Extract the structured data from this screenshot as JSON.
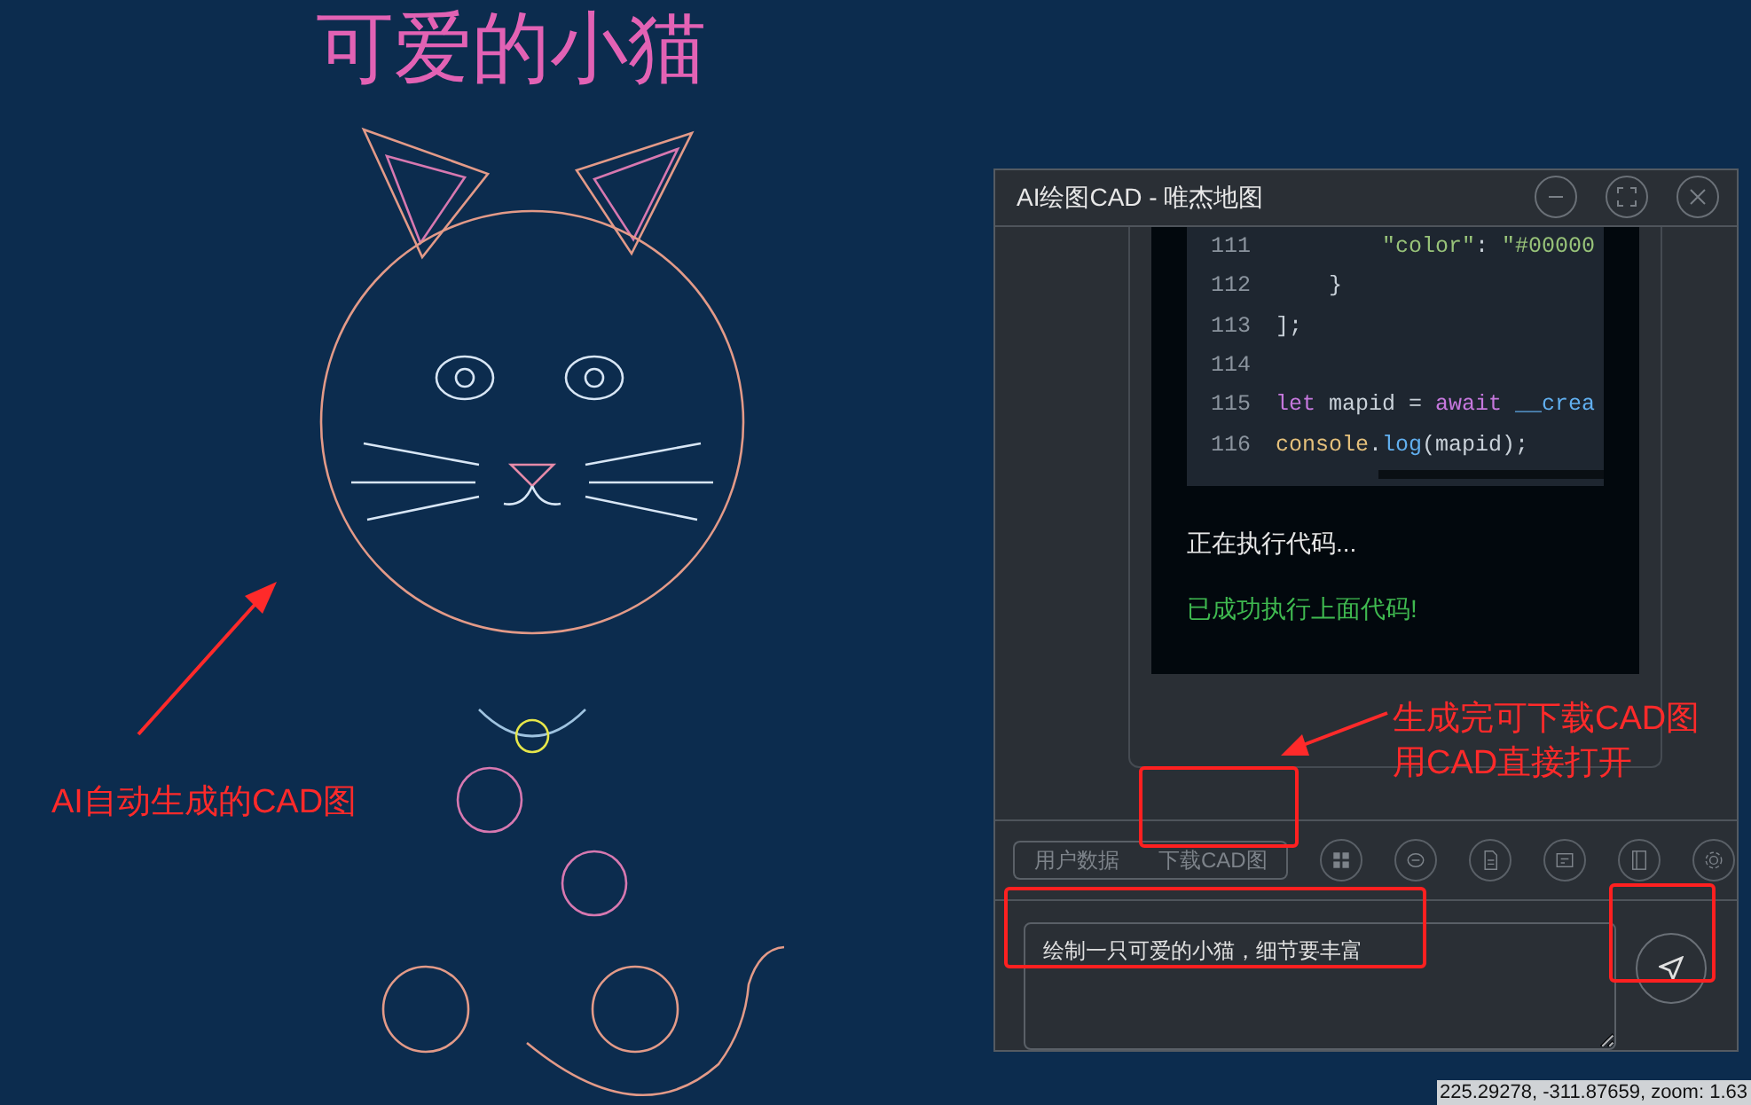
{
  "canvas": {
    "title": "可爱的小猫",
    "annotation_left": "AI自动生成的CAD图",
    "annotation_right": [
      "生成完可下载CAD图",
      "用CAD直接打开"
    ]
  },
  "panel": {
    "title": "AI绘图CAD - 唯杰地图",
    "code_lines": [
      {
        "number": "111",
        "tokens": [
          {
            "kind": "string",
            "text": "        \"color\""
          },
          {
            "kind": "plain",
            "text": ": "
          },
          {
            "kind": "string",
            "text": "\"#00000"
          }
        ]
      },
      {
        "number": "112",
        "tokens": [
          {
            "kind": "plain",
            "text": "    }"
          }
        ]
      },
      {
        "number": "113",
        "tokens": [
          {
            "kind": "plain",
            "text": "];"
          }
        ]
      },
      {
        "number": "114"
      },
      {
        "number": "115",
        "tokens": [
          {
            "kind": "keyword",
            "text": "let"
          },
          {
            "kind": "plain",
            "text": " mapid = "
          },
          {
            "kind": "keyword",
            "text": "await"
          },
          {
            "kind": "function",
            "text": " __crea"
          }
        ]
      },
      {
        "number": "116",
        "tokens": [
          {
            "kind": "object",
            "text": "console"
          },
          {
            "kind": "plain",
            "text": "."
          },
          {
            "kind": "function",
            "text": "log"
          },
          {
            "kind": "plain",
            "text": "(mapid);"
          }
        ]
      }
    ],
    "messages": [
      {
        "kind": "info",
        "text": "正在执行代码..."
      },
      {
        "kind": "success",
        "text": "已成功执行上面代码!"
      }
    ],
    "buttons": [
      "用户数据",
      "下载CAD图"
    ],
    "input": {
      "value": "绘制一只可爱的小猫，细节要丰富"
    }
  },
  "status_bar": {
    "coordinates": "225.29278, -311.87659, zoom: 1.63"
  }
}
